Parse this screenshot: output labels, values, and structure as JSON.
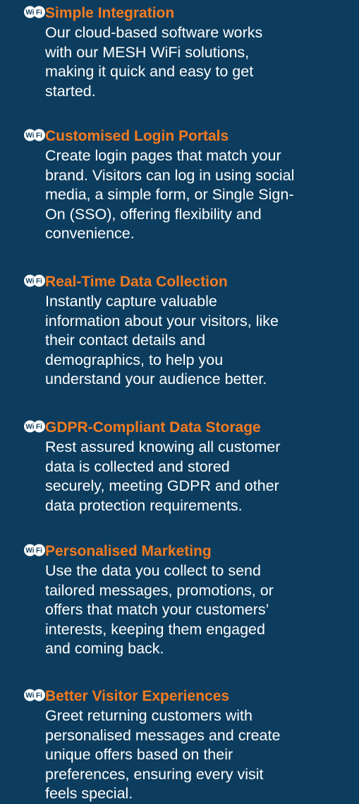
{
  "colors": {
    "background": "#0d3d5e",
    "title": "#f47b20",
    "text": "#ffffff"
  },
  "features": [
    {
      "icon": "wifi-icon",
      "title": "Simple Integration",
      "lines": [
        "Our cloud-based software works",
        "with our MESH WiFi solutions,",
        "making it quick and easy to get",
        "started."
      ]
    },
    {
      "icon": "wifi-icon",
      "title": "Customised Login Portals",
      "lines": [
        "Create login pages that match your",
        "brand. Visitors can log in using social",
        "media, a simple form, or Single Sign-",
        "On (SSO), offering flexibility and",
        "convenience."
      ]
    },
    {
      "icon": "wifi-icon",
      "title": "Real-Time Data Collection",
      "lines": [
        "Instantly capture valuable",
        "information about your visitors, like",
        "their contact details and",
        "demographics, to help you",
        "understand your audience better."
      ]
    },
    {
      "icon": "wifi-icon",
      "title": "GDPR-Compliant Data Storage",
      "lines": [
        "Rest assured knowing all customer",
        "data is collected and stored",
        "securely, meeting GDPR and other",
        "data protection requirements."
      ]
    },
    {
      "icon": "wifi-icon",
      "title": "Personalised Marketing",
      "lines": [
        "Use the data you collect to send",
        "tailored messages, promotions, or",
        "offers that match your customers’",
        "interests, keeping them engaged",
        "and coming back."
      ]
    },
    {
      "icon": "wifi-icon",
      "title": "Better Visitor Experiences",
      "lines": [
        "Greet returning customers with",
        "personalised messages and create",
        "unique offers based on their",
        "preferences, ensuring every visit",
        "feels special."
      ]
    }
  ]
}
